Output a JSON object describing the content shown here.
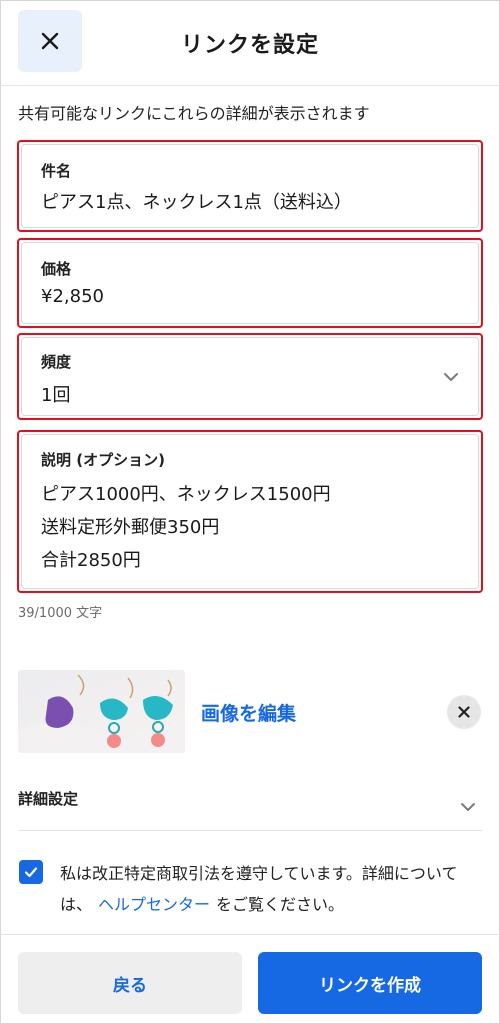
{
  "header": {
    "title": "リンクを設定",
    "close_icon": "close-icon"
  },
  "subtitle": "共有可能なリンクにこれらの詳細が表示されます",
  "fields": {
    "subject": {
      "label": "件名",
      "value": "ピアス1点、ネックレス1点（送料込）"
    },
    "price": {
      "label": "価格",
      "value": "¥2,850"
    },
    "frequency": {
      "label": "頻度",
      "value": "1回",
      "icon": "chevron-down-icon"
    },
    "description": {
      "label": "説明 (オプション)",
      "value": "ピアス1000円、ネックレス1500円\n送料定形外郵便350円\n合計2850円"
    }
  },
  "char_counter": "39/1000 文字",
  "image": {
    "edit_label": "画像を編集",
    "remove_icon": "close-icon"
  },
  "advanced": {
    "label": "詳細設定",
    "icon": "chevron-down-icon"
  },
  "consent": {
    "checked": true,
    "text_before": "私は改正特定商取引法を遵守しています。詳細については、",
    "link": "ヘルプセンター",
    "text_after": "をご覧ください。"
  },
  "footer": {
    "back_label": "戻る",
    "create_label": "リンクを作成"
  },
  "colors": {
    "accent": "#1668e3",
    "highlight_border": "#e2101d",
    "close_bg": "#e8f0fb"
  }
}
